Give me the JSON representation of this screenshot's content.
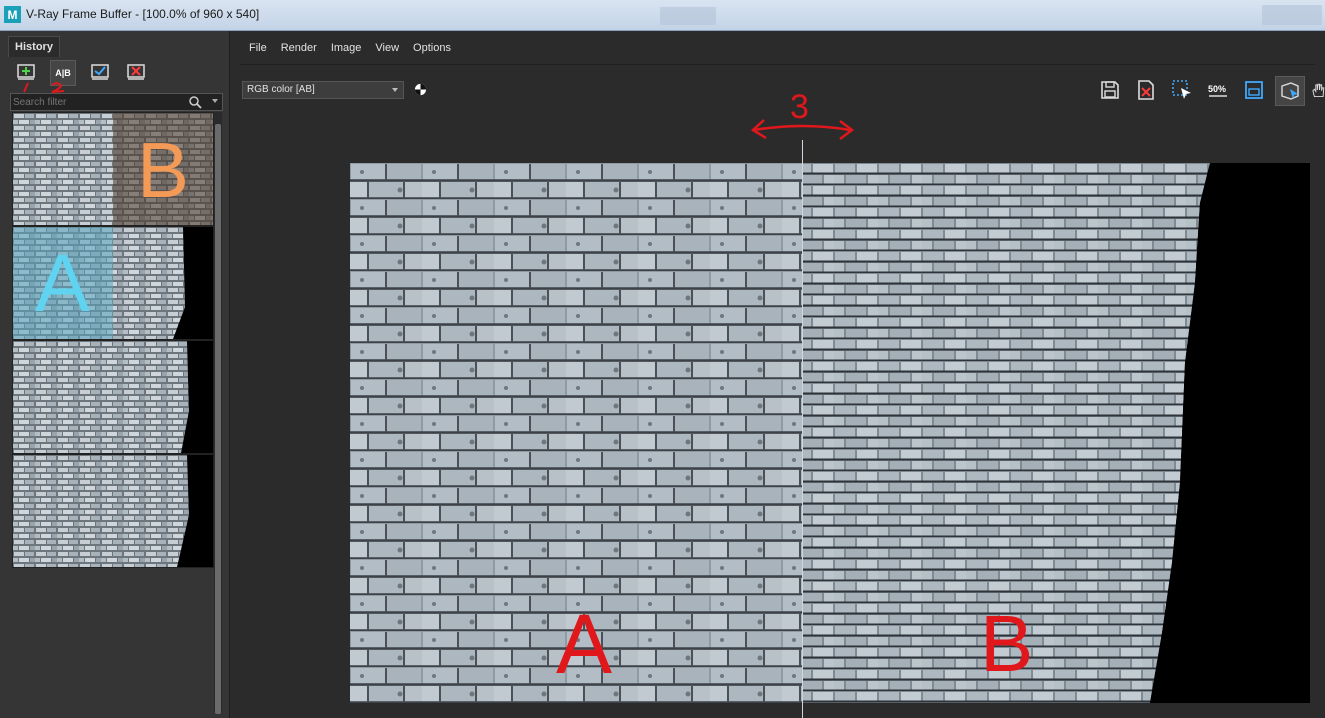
{
  "window": {
    "title": "V-Ray Frame Buffer - [100.0% of 960 x 540]",
    "icon_letter": "M"
  },
  "history": {
    "tab_label": "History",
    "toolbar": [
      {
        "name": "save-to-history-icon"
      },
      {
        "name": "ab-compare-icon",
        "glyph": "A|B"
      },
      {
        "name": "load-history-icon"
      },
      {
        "name": "remove-history-icon"
      }
    ],
    "search_placeholder": "Search filter",
    "thumbnails": [
      {
        "overlay_letter": "B",
        "overlay_color": "#f39a57"
      },
      {
        "overlay_letter": "A",
        "overlay_color": "#5fd3f0"
      },
      {
        "overlay_letter": ""
      },
      {
        "overlay_letter": ""
      }
    ],
    "annotations": [
      "1",
      "2"
    ]
  },
  "menu": [
    "File",
    "Render",
    "Image",
    "View",
    "Options"
  ],
  "channel": {
    "selected": "RGB color [AB]"
  },
  "right_toolbar": [
    {
      "name": "save-image-icon"
    },
    {
      "name": "clear-image-icon"
    },
    {
      "name": "region-render-icon"
    },
    {
      "name": "zoom-50-icon",
      "label": "50%"
    },
    {
      "name": "lens-effects-icon"
    },
    {
      "name": "track-mouse-icon"
    },
    {
      "name": "pan-hand-icon"
    }
  ],
  "viewport_annotations": {
    "left": "A",
    "right": "B",
    "arrow_number": "3"
  },
  "colors": {
    "annotation": "#e0181c",
    "background": "#2b2b2b",
    "panel": "#353535"
  }
}
